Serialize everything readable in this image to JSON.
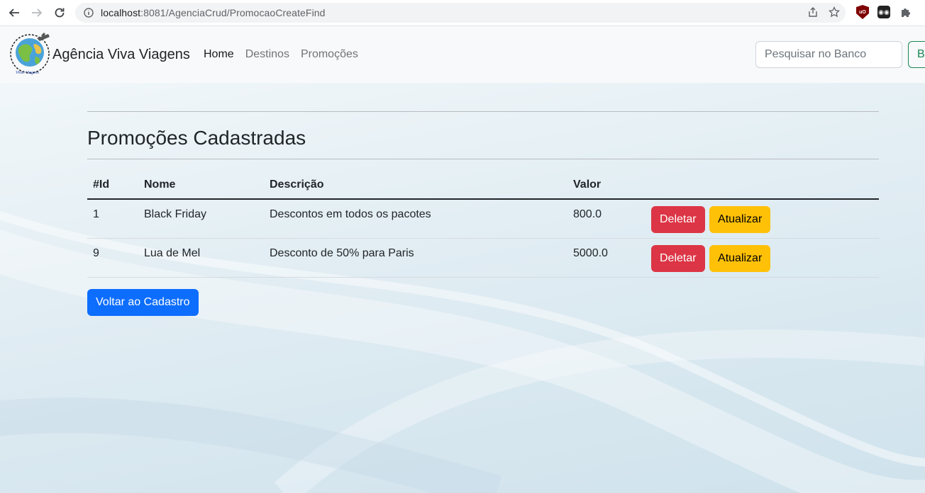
{
  "browser": {
    "url_host": "localhost",
    "url_rest": ":8081/AgenciaCrud/PromocaoCreateFind"
  },
  "navbar": {
    "brand": "Agência Viva Viagens",
    "logo_caption": "Viva! Viagens",
    "links": [
      {
        "label": "Home",
        "active": true
      },
      {
        "label": "Destinos",
        "active": false
      },
      {
        "label": "Promoções",
        "active": false
      }
    ],
    "search_placeholder": "Pesquisar no Banco",
    "search_button": "B"
  },
  "main": {
    "title": "Promoções Cadastradas",
    "table": {
      "headers": [
        "#Id",
        "Nome",
        "Descrição",
        "Valor",
        ""
      ],
      "rows": [
        {
          "id": "1",
          "nome": "Black Friday",
          "descricao": "Descontos em todos os pacotes",
          "valor": "800.0"
        },
        {
          "id": "9",
          "nome": "Lua de Mel",
          "descricao": "Desconto de 50% para Paris",
          "valor": "5000.0"
        }
      ],
      "delete_label": "Deletar",
      "update_label": "Atualizar"
    },
    "back_button": "Voltar ao Cadastro"
  },
  "colors": {
    "danger": "#dc3545",
    "warning": "#ffc107",
    "primary": "#0d6efd",
    "success": "#198754"
  }
}
